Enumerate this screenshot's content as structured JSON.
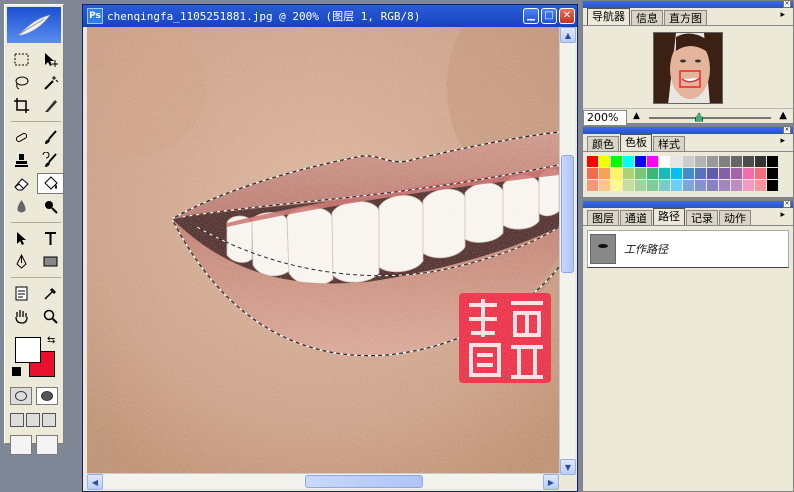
{
  "document": {
    "title": "chenqingfa_1105251881.jpg @ 200% (图层 1, RGB/8)",
    "icon_label": "Ps",
    "minimize_glyph": "▁",
    "maximize_glyph": "□",
    "close_glyph": "✕"
  },
  "toolbox": {
    "logo_icon": "feather-icon",
    "swap_glyph": "⇆"
  },
  "navigator": {
    "tabs": [
      "导航器",
      "信息",
      "直方图"
    ],
    "active_tab": 0,
    "zoom_value": "200%",
    "menu_glyph": "▸",
    "zoom_out_glyph": "▲",
    "zoom_in_glyph": "▲"
  },
  "color_panel": {
    "tabs": [
      "颜色",
      "色板",
      "样式"
    ],
    "active_tab": 1,
    "menu_glyph": "▸",
    "swatches": [
      "#ff0000",
      "#ffff00",
      "#00ff00",
      "#00ffff",
      "#0000ff",
      "#ff00ff",
      "#ffffff",
      "#e6e6e6",
      "#cccccc",
      "#b3b3b3",
      "#999999",
      "#808080",
      "#666666",
      "#4d4d4d",
      "#333333",
      "#000000",
      "#f26c4f",
      "#f8a054",
      "#fff467",
      "#acd373",
      "#7cc576",
      "#3bb878",
      "#1abbb4",
      "#00bff3",
      "#438ccb",
      "#5574b9",
      "#605ca9",
      "#855fa8",
      "#a763a9",
      "#f06ea9",
      "#f26d7d",
      "#000000",
      "#f7977a",
      "#fdc68a",
      "#fff799",
      "#c4df9b",
      "#a2d39c",
      "#82ca9c",
      "#7accc8",
      "#6dcff6",
      "#7ea7d8",
      "#8493ca",
      "#8882be",
      "#a187be",
      "#bc8dbf",
      "#f49ac2",
      "#f5989d",
      "#000000"
    ]
  },
  "paths_panel": {
    "tabs": [
      "图层",
      "通道",
      "路径",
      "记录",
      "动作"
    ],
    "active_tab": 2,
    "menu_glyph": "▸",
    "items": [
      {
        "name": "工作路径"
      }
    ]
  }
}
